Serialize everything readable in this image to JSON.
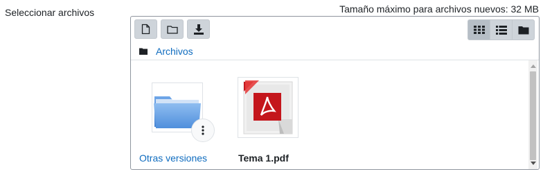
{
  "form": {
    "field_label": "Seleccionar archivos",
    "max_size_text": "Tamaño máximo para archivos nuevos: 32 MB"
  },
  "toolbar": {
    "buttons": [
      {
        "name": "add-file-button",
        "icon": "file-icon"
      },
      {
        "name": "create-folder-button",
        "icon": "folder-icon"
      },
      {
        "name": "download-button",
        "icon": "download-icon"
      }
    ],
    "views": [
      {
        "name": "view-icons-button",
        "icon": "grid-icon",
        "active": true
      },
      {
        "name": "view-list-button",
        "icon": "list-icon",
        "active": false
      },
      {
        "name": "view-tree-button",
        "icon": "folder-icon",
        "active": false
      }
    ]
  },
  "breadcrumb": {
    "label": "Archivos",
    "icon": "folder-icon"
  },
  "files": [
    {
      "label": "Otras versiones",
      "type": "folder",
      "icon": "folder-icon"
    },
    {
      "label": "Tema 1.pdf",
      "type": "pdf",
      "icon": "pdf-icon"
    }
  ],
  "colors": {
    "link": "#0f6cbf",
    "button_bg": "#ced4da",
    "border": "#8f959e",
    "pdf_red": "#c4161c"
  }
}
